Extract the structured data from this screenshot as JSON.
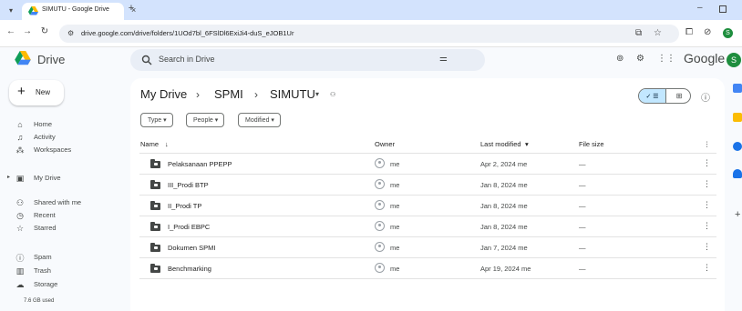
{
  "browser": {
    "tab_title": "SIMUTU - Google Drive",
    "url": "drive.google.com/drive/folders/1UOd7bl_6FSlDl6ExiJi4-duS_eJOB1Ur",
    "profile_initial": "S"
  },
  "header": {
    "app_name": "Drive",
    "search_placeholder": "Search in Drive",
    "brand_word": "Google",
    "avatar_initial": "S"
  },
  "sidebar": {
    "new_label": "New",
    "items": [
      {
        "label": "Home",
        "icon": "home-icon"
      },
      {
        "label": "Activity",
        "icon": "bell-icon"
      },
      {
        "label": "Workspaces",
        "icon": "workspaces-icon"
      },
      {
        "label": "My Drive",
        "icon": "drive-icon"
      },
      {
        "label": "Shared with me",
        "icon": "people-icon"
      },
      {
        "label": "Recent",
        "icon": "clock-icon"
      },
      {
        "label": "Starred",
        "icon": "star-icon"
      },
      {
        "label": "Spam",
        "icon": "spam-icon"
      },
      {
        "label": "Trash",
        "icon": "trash-icon"
      },
      {
        "label": "Storage",
        "icon": "cloud-icon"
      }
    ],
    "storage_used": "7.6 GB used"
  },
  "main": {
    "breadcrumb": [
      "My Drive",
      "SPMI",
      "SIMUTU"
    ],
    "filters": [
      "Type",
      "People",
      "Modified"
    ],
    "columns": {
      "name": "Name",
      "owner": "Owner",
      "modified": "Last modified",
      "size": "File size"
    },
    "rows": [
      {
        "name": "Pelaksanaan PPEPP",
        "owner": "me",
        "modified": "Apr 2, 2024 me",
        "size": "—"
      },
      {
        "name": "III_Prodi BTP",
        "owner": "me",
        "modified": "Jan 8, 2024 me",
        "size": "—"
      },
      {
        "name": "II_Prodi TP",
        "owner": "me",
        "modified": "Jan 8, 2024 me",
        "size": "—"
      },
      {
        "name": "I_Prodi EBPC",
        "owner": "me",
        "modified": "Jan 8, 2024 me",
        "size": "—"
      },
      {
        "name": "Dokumen SPMI",
        "owner": "me",
        "modified": "Jan 7, 2024 me",
        "size": "—"
      },
      {
        "name": "Benchmarking",
        "owner": "me",
        "modified": "Apr 19, 2024 me",
        "size": "—"
      }
    ]
  },
  "colors": {
    "accent": "#c2e7ff",
    "tabstrip": "#d3e3fd",
    "avatar": "#1e8e3e"
  }
}
